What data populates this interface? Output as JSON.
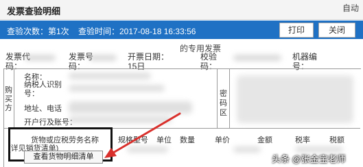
{
  "window": {
    "title": "发票查验明细",
    "top_right": "自动"
  },
  "info_bar": {
    "count_label": "查验次数：第1次",
    "time_label": "查验时间：2017-08-18 16:33:56",
    "print_button": "打印",
    "close_button": "关闭"
  },
  "invoice": {
    "subtitle": "的专用发票",
    "header_fields": [
      {
        "label": "发票代码",
        "text": "发票代\n码："
      },
      {
        "label": "发票号码",
        "text": "发票号\n码："
      },
      {
        "label": "开票日期",
        "text": "开票日期：\n15日"
      },
      {
        "label": "校验码",
        "text": "校验\n码："
      },
      {
        "label": "机器编号",
        "text": "机器编\n号："
      }
    ],
    "buyer_side_label": "购买方",
    "buyer_fields": [
      "名称：",
      "纳税人识别号：",
      "地址、电话",
      "开户行及账号："
    ],
    "password_area": "密码区",
    "goods_header": "货物或应税劳务名称",
    "goods_note": "(详见销货清单)",
    "columns": [
      "规格型号",
      "单位",
      "数量",
      "单价",
      "金额",
      "税率",
      "税额"
    ],
    "view_goods_button": "查看货物明细清单"
  },
  "watermark": "头条 @张金宝老师",
  "colors": {
    "info_bar": "#1f71c4",
    "annotation_arrow": "#d9302c"
  }
}
